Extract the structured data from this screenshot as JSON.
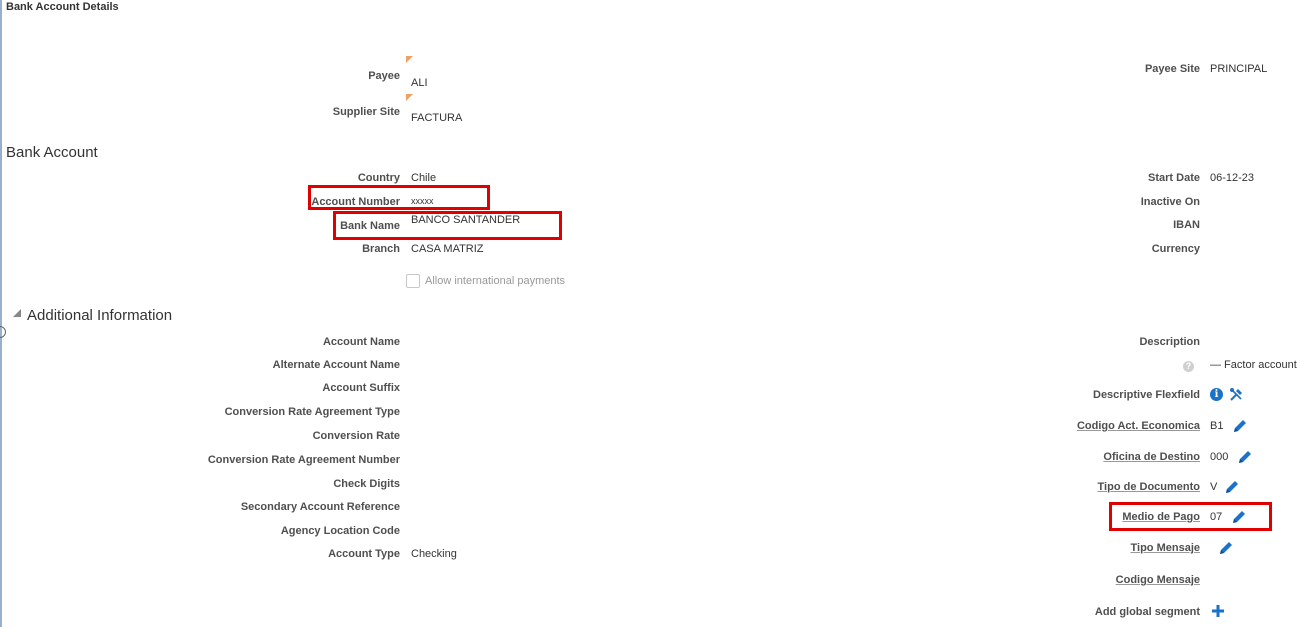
{
  "page": {
    "title": "Bank Account Details"
  },
  "payee_section": {
    "payee_label": "Payee",
    "payee_value": "ALI",
    "supplier_site_label": "Supplier Site",
    "supplier_site_value": "FACTURA",
    "payee_site_label": "Payee Site",
    "payee_site_value": "PRINCIPAL"
  },
  "bank_account": {
    "heading": "Bank Account",
    "country_label": "Country",
    "country_value": "Chile",
    "account_number_label": "Account Number",
    "account_number_value": "xxxxx",
    "bank_name_label": "Bank Name",
    "bank_name_value": "BANCO SANTANDER",
    "branch_label": "Branch",
    "branch_value": "CASA MATRIZ",
    "intl_payments_label": "Allow international payments",
    "start_date_label": "Start Date",
    "start_date_value": "06-12-23",
    "inactive_on_label": "Inactive On",
    "iban_label": "IBAN",
    "currency_label": "Currency"
  },
  "additional_info": {
    "heading": "Additional Information",
    "account_name_label": "Account Name",
    "alternate_account_name_label": "Alternate Account Name",
    "account_suffix_label": "Account Suffix",
    "conversion_rate_agreement_type_label": "Conversion Rate Agreement Type",
    "conversion_rate_label": "Conversion Rate",
    "conversion_rate_agreement_number_label": "Conversion Rate Agreement Number",
    "check_digits_label": "Check Digits",
    "secondary_account_reference_label": "Secondary Account Reference",
    "agency_location_code_label": "Agency Location Code",
    "account_type_label": "Account Type",
    "account_type_value": "Checking",
    "description_label": "Description",
    "description_value": "— Factor account",
    "descriptive_flexfield_label": "Descriptive Flexfield",
    "codigo_act_label": "Codigo Act. Economica",
    "codigo_act_value": "B1",
    "oficina_label": "Oficina de Destino",
    "oficina_value": "000",
    "tipo_documento_label": "Tipo de Documento",
    "tipo_documento_value": "V",
    "medio_pago_label": "Medio de Pago",
    "medio_pago_value": "07",
    "tipo_mensaje_label": "Tipo Mensaje",
    "codigo_mensaje_label": "Codigo Mensaje",
    "add_global_segment_label": "Add global segment"
  },
  "colors": {
    "accent": "#1a73c8",
    "highlight": "#e00000",
    "flag": "#f0a060"
  }
}
